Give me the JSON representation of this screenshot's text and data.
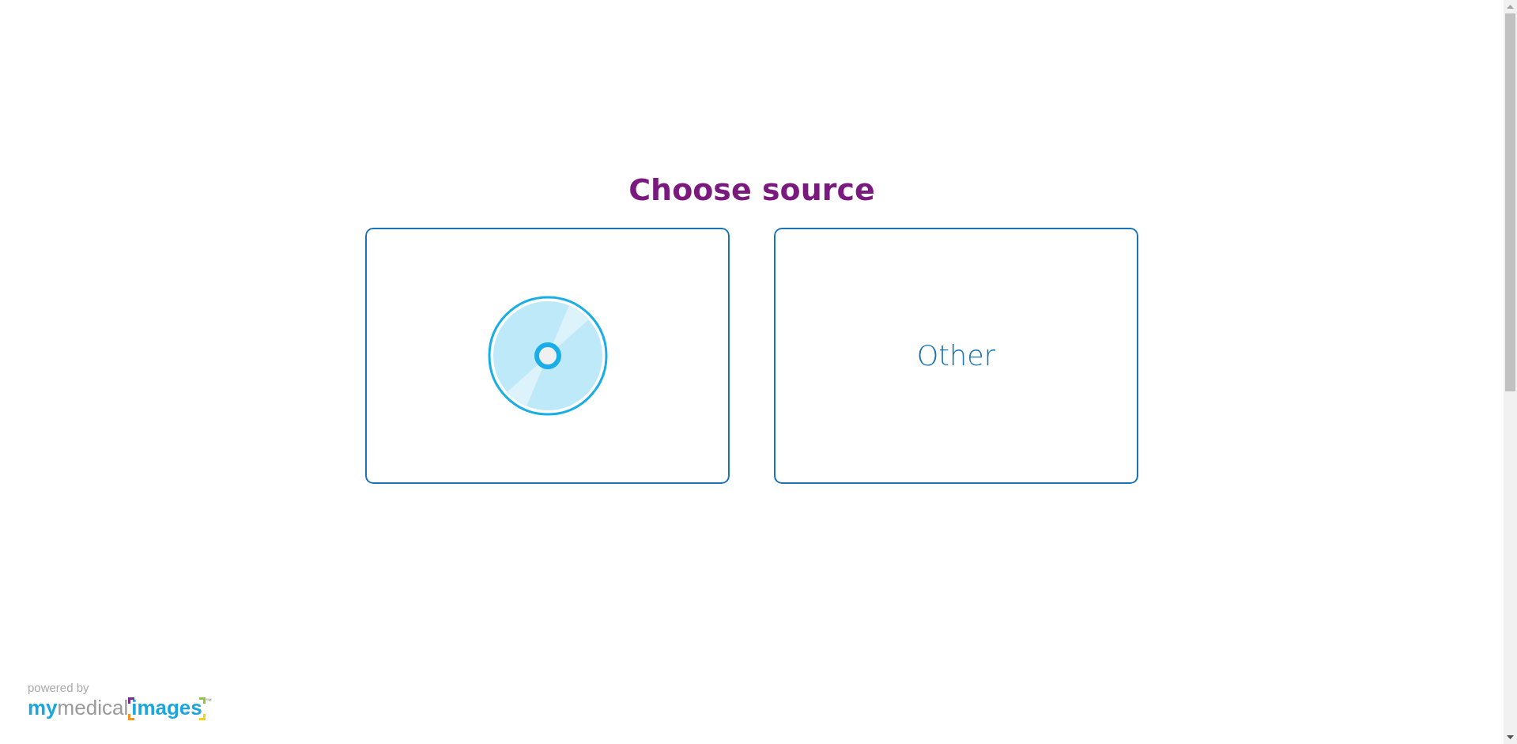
{
  "title": "Choose source",
  "sources": [
    {
      "kind": "disc"
    },
    {
      "kind": "text",
      "label": "Other"
    }
  ],
  "footer": {
    "powered_by": "powered by",
    "logo": [
      "my",
      "medical",
      "images"
    ],
    "trademark": "™"
  }
}
